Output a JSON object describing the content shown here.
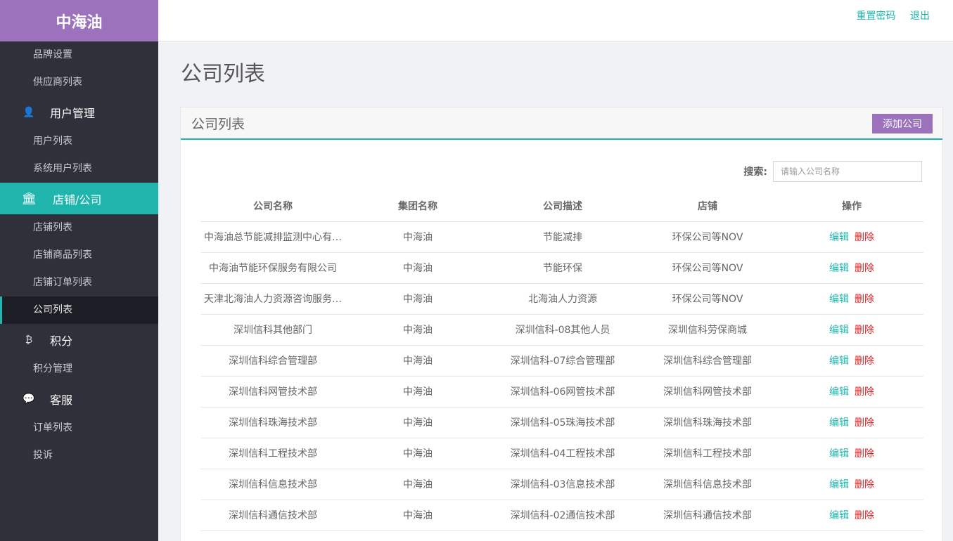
{
  "brand": "中海油",
  "header": {
    "reset_password": "重置密码",
    "logout": "退出"
  },
  "sidebar": {
    "items": [
      {
        "type": "sub",
        "label": "品牌设置",
        "name": "sidebar-item-brand-settings"
      },
      {
        "type": "sub",
        "label": "供应商列表",
        "name": "sidebar-item-supplier-list"
      },
      {
        "type": "group",
        "label": "用户管理",
        "icon": "user-icon",
        "glyph": "👤",
        "name": "sidebar-group-user-management"
      },
      {
        "type": "sub",
        "label": "用户列表",
        "name": "sidebar-item-user-list"
      },
      {
        "type": "sub",
        "label": "系统用户列表",
        "name": "sidebar-item-system-user-list"
      },
      {
        "type": "group",
        "label": "店铺/公司",
        "icon": "bank-icon",
        "glyph": "🏛",
        "active": true,
        "name": "sidebar-group-store-company"
      },
      {
        "type": "sub",
        "label": "店铺列表",
        "name": "sidebar-item-store-list"
      },
      {
        "type": "sub",
        "label": "店铺商品列表",
        "name": "sidebar-item-store-product-list"
      },
      {
        "type": "sub",
        "label": "店铺订单列表",
        "name": "sidebar-item-store-order-list"
      },
      {
        "type": "sub",
        "label": "公司列表",
        "active": true,
        "name": "sidebar-item-company-list"
      },
      {
        "type": "group",
        "label": "积分",
        "icon": "bitcoin-icon",
        "glyph": "₿",
        "name": "sidebar-group-points"
      },
      {
        "type": "sub",
        "label": "积分管理",
        "name": "sidebar-item-points-management"
      },
      {
        "type": "group",
        "label": "客服",
        "icon": "chat-icon",
        "glyph": "💬",
        "name": "sidebar-group-customer-service"
      },
      {
        "type": "sub",
        "label": "订单列表",
        "name": "sidebar-item-order-list"
      },
      {
        "type": "sub",
        "label": "投诉",
        "name": "sidebar-item-complaints"
      }
    ]
  },
  "main": {
    "page_title": "公司列表",
    "panel_title": "公司列表",
    "add_button": "添加公司",
    "search_label": "搜索:",
    "search_placeholder": "请输入公司名称",
    "columns": [
      "公司名称",
      "集团名称",
      "公司描述",
      "店铺",
      "操作"
    ],
    "edit_label": "编辑",
    "delete_label": "删除",
    "rows": [
      [
        "中海油总节能减排监测中心有…",
        "中海油",
        "节能减排",
        "环保公司等NOV"
      ],
      [
        "中海油节能环保服务有限公司",
        "中海油",
        "节能环保",
        "环保公司等NOV"
      ],
      [
        "天津北海油人力资源咨询服务…",
        "中海油",
        "北海油人力资源",
        "环保公司等NOV"
      ],
      [
        "深圳信科其他部门",
        "中海油",
        "深圳信科-08其他人员",
        "深圳信科劳保商城"
      ],
      [
        "深圳信科综合管理部",
        "中海油",
        "深圳信科-07综合管理部",
        "深圳信科综合管理部"
      ],
      [
        "深圳信科网管技术部",
        "中海油",
        "深圳信科-06网管技术部",
        "深圳信科网管技术部"
      ],
      [
        "深圳信科珠海技术部",
        "中海油",
        "深圳信科-05珠海技术部",
        "深圳信科珠海技术部"
      ],
      [
        "深圳信科工程技术部",
        "中海油",
        "深圳信科-04工程技术部",
        "深圳信科工程技术部"
      ],
      [
        "深圳信科信息技术部",
        "中海油",
        "深圳信科-03信息技术部",
        "深圳信科信息技术部"
      ],
      [
        "深圳信科通信技术部",
        "中海油",
        "深圳信科-02通信技术部",
        "深圳信科通信技术部"
      ]
    ]
  }
}
